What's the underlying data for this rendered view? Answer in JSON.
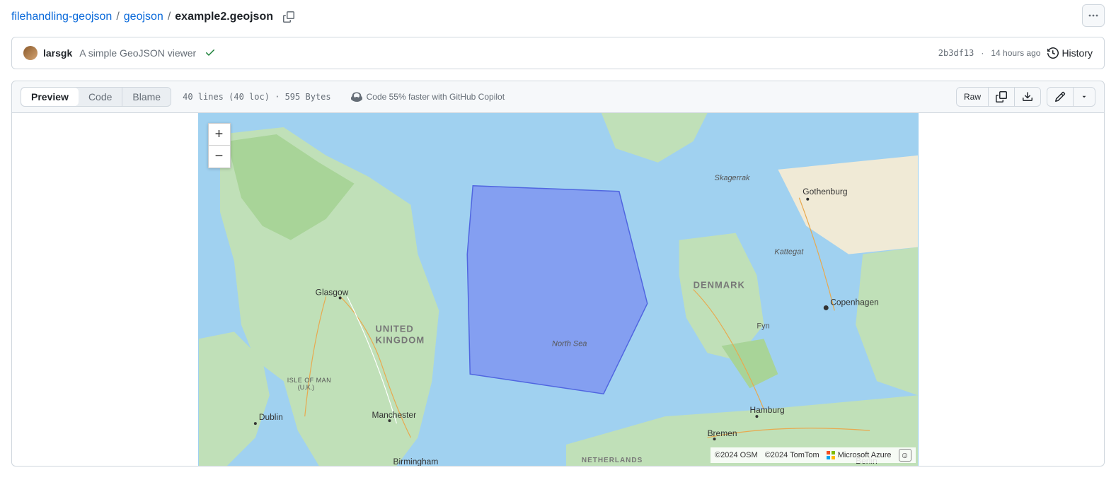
{
  "breadcrumb": {
    "parts": [
      "filehandling-geojson",
      "geojson"
    ],
    "current": "example2.geojson"
  },
  "commit": {
    "author": "larsgk",
    "message": "A simple GeoJSON viewer",
    "sha": "2b3df13",
    "time": "14 hours ago",
    "history_label": "History"
  },
  "tabs": {
    "preview": "Preview",
    "code": "Code",
    "blame": "Blame"
  },
  "file_meta": "40 lines (40 loc) · 595 Bytes",
  "copilot_msg": "Code 55% faster with GitHub Copilot",
  "raw_label": "Raw",
  "map": {
    "labels": {
      "uk": "UNITED\nKINGDOM",
      "denmark": "DENMARK",
      "netherlands": "NETHERLANDS",
      "north_sea": "North Sea",
      "skagerrak": "Skagerrak",
      "kattegat": "Kattegat",
      "isle_of_man": "ISLE OF MAN\n(U.K.)",
      "fyn": "Fyn"
    },
    "cities": {
      "glasgow": "Glasgow",
      "dublin": "Dublin",
      "manchester": "Manchester",
      "birmingham": "Birmingham",
      "gothenburg": "Gothenburg",
      "copenhagen": "Copenhagen",
      "hamburg": "Hamburg",
      "bremen": "Bremen",
      "berlin": "Berlin"
    },
    "attribution": {
      "osm": "©2024 OSM",
      "tomtom": "©2024 TomTom",
      "azure": "Microsoft Azure"
    }
  }
}
